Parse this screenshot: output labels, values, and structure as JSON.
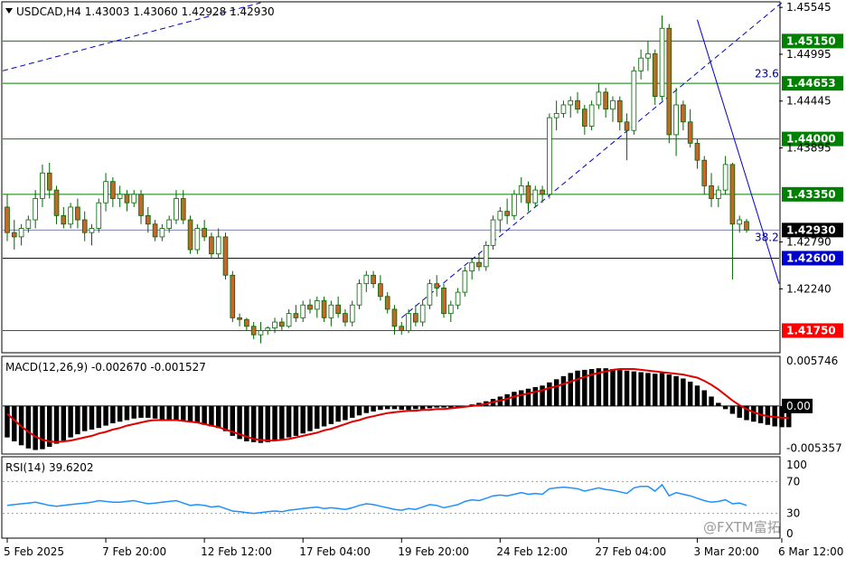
{
  "chart_data": [
    {
      "type": "candlestick",
      "panel": "price",
      "header": "USDCAD,H4  1.43003 1.43060 1.42928 1.42930",
      "header_marker": "triangle-down-icon",
      "ylim": [
        1.415,
        1.456
      ],
      "y_ticks": [
        "1.45545",
        "1.44995",
        "1.44445",
        "1.43895",
        "1.42790",
        "1.42240"
      ],
      "y_tick_values": [
        1.45545,
        1.44995,
        1.44445,
        1.43895,
        1.4279,
        1.4224
      ],
      "levels": [
        {
          "label": "1.45150",
          "value": 1.4515,
          "color": "#008000",
          "label_bg": "#008000",
          "label_color": "#ffffff"
        },
        {
          "label": "1.44653",
          "value": 1.44653,
          "color": "#008000",
          "label_bg": "#008000",
          "label_color": "#ffffff"
        },
        {
          "label": "1.44000",
          "value": 1.44,
          "color": "#008000",
          "label_bg": "#008000",
          "label_color": "#ffffff"
        },
        {
          "label": "1.43350",
          "value": 1.4335,
          "color": "#008000",
          "label_bg": "#008000",
          "label_color": "#ffffff"
        },
        {
          "label": "1.42930",
          "value": 1.4293,
          "color": "#7f7fae",
          "label_bg": "#000000",
          "label_color": "#ffffff"
        },
        {
          "label": "1.42600",
          "value": 1.426,
          "color": "#0000cc",
          "label_bg": "#0000cc",
          "label_color": "#ffffff"
        },
        {
          "label": "1.41750",
          "value": 1.4175,
          "color": "#ff0000",
          "label_bg": "#ff0000",
          "label_color": "#ffffff"
        }
      ],
      "fib_labels": [
        {
          "label": "23.6",
          "value": 1.4469
        },
        {
          "label": "38.2",
          "value": 1.4277
        }
      ],
      "candles": [
        [
          1.432,
          1.4335,
          1.428,
          1.429
        ],
        [
          1.429,
          1.4305,
          1.427,
          1.4285
        ],
        [
          1.4285,
          1.43,
          1.4275,
          1.4295
        ],
        [
          1.4295,
          1.431,
          1.429,
          1.4305
        ],
        [
          1.4305,
          1.434,
          1.4295,
          1.433
        ],
        [
          1.433,
          1.437,
          1.432,
          1.436
        ],
        [
          1.436,
          1.4372,
          1.433,
          1.434
        ],
        [
          1.434,
          1.4345,
          1.43,
          1.431
        ],
        [
          1.431,
          1.432,
          1.4295,
          1.43
        ],
        [
          1.43,
          1.4325,
          1.4295,
          1.432
        ],
        [
          1.432,
          1.433,
          1.4295,
          1.4305
        ],
        [
          1.4305,
          1.4315,
          1.428,
          1.429
        ],
        [
          1.429,
          1.43,
          1.4275,
          1.4295
        ],
        [
          1.4295,
          1.433,
          1.429,
          1.4325
        ],
        [
          1.4325,
          1.436,
          1.4315,
          1.435
        ],
        [
          1.435,
          1.4355,
          1.432,
          1.433
        ],
        [
          1.433,
          1.4345,
          1.432,
          1.4335
        ],
        [
          1.4335,
          1.434,
          1.4315,
          1.4325
        ],
        [
          1.4325,
          1.434,
          1.432,
          1.4335
        ],
        [
          1.4335,
          1.434,
          1.43,
          1.431
        ],
        [
          1.431,
          1.432,
          1.429,
          1.43
        ],
        [
          1.43,
          1.4305,
          1.428,
          1.4285
        ],
        [
          1.4285,
          1.43,
          1.428,
          1.4295
        ],
        [
          1.4295,
          1.431,
          1.429,
          1.4305
        ],
        [
          1.4305,
          1.434,
          1.43,
          1.433
        ],
        [
          1.433,
          1.434,
          1.43,
          1.4305
        ],
        [
          1.4305,
          1.431,
          1.4265,
          1.427
        ],
        [
          1.427,
          1.43,
          1.4265,
          1.4295
        ],
        [
          1.4295,
          1.4305,
          1.428,
          1.4285
        ],
        [
          1.4285,
          1.429,
          1.426,
          1.4265
        ],
        [
          1.4265,
          1.4295,
          1.426,
          1.4285
        ],
        [
          1.4285,
          1.429,
          1.4235,
          1.424
        ],
        [
          1.424,
          1.4245,
          1.4185,
          1.419
        ],
        [
          1.419,
          1.4195,
          1.418,
          1.4188
        ],
        [
          1.4188,
          1.419,
          1.4175,
          1.418
        ],
        [
          1.418,
          1.4185,
          1.4165,
          1.417
        ],
        [
          1.417,
          1.4185,
          1.416,
          1.4175
        ],
        [
          1.4175,
          1.418,
          1.417,
          1.4178
        ],
        [
          1.4178,
          1.419,
          1.4172,
          1.4185
        ],
        [
          1.4185,
          1.419,
          1.4175,
          1.418
        ],
        [
          1.418,
          1.42,
          1.4178,
          1.4195
        ],
        [
          1.4195,
          1.4205,
          1.4185,
          1.419
        ],
        [
          1.419,
          1.421,
          1.4185,
          1.4205
        ],
        [
          1.4205,
          1.4212,
          1.4195,
          1.42
        ],
        [
          1.42,
          1.4215,
          1.419,
          1.421
        ],
        [
          1.421,
          1.4215,
          1.4185,
          1.419
        ],
        [
          1.419,
          1.421,
          1.418,
          1.4205
        ],
        [
          1.4205,
          1.4215,
          1.419,
          1.4195
        ],
        [
          1.4195,
          1.42,
          1.418,
          1.4185
        ],
        [
          1.4185,
          1.421,
          1.418,
          1.4205
        ],
        [
          1.4205,
          1.4235,
          1.42,
          1.423
        ],
        [
          1.423,
          1.4245,
          1.422,
          1.424
        ],
        [
          1.424,
          1.4245,
          1.4225,
          1.423
        ],
        [
          1.423,
          1.424,
          1.421,
          1.4215
        ],
        [
          1.4215,
          1.422,
          1.4195,
          1.42
        ],
        [
          1.42,
          1.4205,
          1.417,
          1.418
        ],
        [
          1.418,
          1.4185,
          1.417,
          1.4175
        ],
        [
          1.4175,
          1.42,
          1.4172,
          1.4195
        ],
        [
          1.4195,
          1.4205,
          1.418,
          1.4185
        ],
        [
          1.4185,
          1.421,
          1.418,
          1.4205
        ],
        [
          1.4205,
          1.4235,
          1.42,
          1.423
        ],
        [
          1.423,
          1.424,
          1.4215,
          1.4225
        ],
        [
          1.4225,
          1.423,
          1.419,
          1.4195
        ],
        [
          1.4195,
          1.421,
          1.4185,
          1.4205
        ],
        [
          1.4205,
          1.4225,
          1.42,
          1.422
        ],
        [
          1.422,
          1.425,
          1.4215,
          1.4245
        ],
        [
          1.4245,
          1.426,
          1.4235,
          1.4255
        ],
        [
          1.4255,
          1.4265,
          1.4245,
          1.425
        ],
        [
          1.425,
          1.428,
          1.4245,
          1.4275
        ],
        [
          1.4275,
          1.431,
          1.427,
          1.4305
        ],
        [
          1.4305,
          1.432,
          1.429,
          1.4315
        ],
        [
          1.4315,
          1.433,
          1.43,
          1.431
        ],
        [
          1.431,
          1.434,
          1.4305,
          1.4335
        ],
        [
          1.4335,
          1.4355,
          1.4325,
          1.4345
        ],
        [
          1.4345,
          1.435,
          1.4315,
          1.4325
        ],
        [
          1.4325,
          1.4345,
          1.432,
          1.434
        ],
        [
          1.434,
          1.4345,
          1.4325,
          1.4335
        ],
        [
          1.4335,
          1.443,
          1.433,
          1.4425
        ],
        [
          1.4425,
          1.4445,
          1.441,
          1.443
        ],
        [
          1.443,
          1.4445,
          1.4425,
          1.444
        ],
        [
          1.444,
          1.445,
          1.4425,
          1.4445
        ],
        [
          1.4445,
          1.4455,
          1.443,
          1.4435
        ],
        [
          1.4435,
          1.444,
          1.4405,
          1.4415
        ],
        [
          1.4415,
          1.4445,
          1.441,
          1.444
        ],
        [
          1.444,
          1.4465,
          1.4435,
          1.4455
        ],
        [
          1.4455,
          1.446,
          1.4425,
          1.4435
        ],
        [
          1.4435,
          1.445,
          1.442,
          1.4445
        ],
        [
          1.4445,
          1.445,
          1.441,
          1.442
        ],
        [
          1.442,
          1.443,
          1.4375,
          1.441
        ],
        [
          1.441,
          1.4485,
          1.4405,
          1.448
        ],
        [
          1.448,
          1.4505,
          1.447,
          1.4495
        ],
        [
          1.4495,
          1.4515,
          1.448,
          1.45
        ],
        [
          1.45,
          1.4505,
          1.444,
          1.445
        ],
        [
          1.445,
          1.4545,
          1.4445,
          1.453
        ],
        [
          1.453,
          1.4535,
          1.4395,
          1.4405
        ],
        [
          1.4405,
          1.446,
          1.438,
          1.444
        ],
        [
          1.444,
          1.4445,
          1.441,
          1.442
        ],
        [
          1.442,
          1.4435,
          1.439,
          1.4395
        ],
        [
          1.4395,
          1.44,
          1.4365,
          1.4375
        ],
        [
          1.4375,
          1.438,
          1.4335,
          1.4345
        ],
        [
          1.4345,
          1.436,
          1.432,
          1.433
        ],
        [
          1.433,
          1.4345,
          1.432,
          1.434
        ],
        [
          1.434,
          1.438,
          1.4335,
          1.437
        ],
        [
          1.437,
          1.4372,
          1.4235,
          1.43
        ],
        [
          1.43,
          1.431,
          1.429,
          1.4305
        ],
        [
          1.4303,
          1.4306,
          1.429,
          1.4293
        ]
      ]
    },
    {
      "type": "bar+line",
      "panel": "macd",
      "header": "MACD(12,26,9) -0.002670 -0.001527",
      "ylim": [
        -0.006,
        0.0062
      ],
      "y_ticks": [
        "0.005746",
        "0.00",
        "-0.005357"
      ],
      "y_tick_values": [
        0.005746,
        0.0,
        -0.005357
      ],
      "zero_label_bg": "#000000",
      "histogram_color": "#000000",
      "signal_color": "#e00000",
      "histogram": [
        -0.004,
        -0.0045,
        -0.005,
        -0.0054,
        -0.0056,
        -0.0055,
        -0.0052,
        -0.0048,
        -0.0044,
        -0.004,
        -0.0036,
        -0.0032,
        -0.003,
        -0.0028,
        -0.0025,
        -0.0022,
        -0.002,
        -0.0018,
        -0.0016,
        -0.0015,
        -0.0015,
        -0.0016,
        -0.0017,
        -0.0018,
        -0.0018,
        -0.0018,
        -0.002,
        -0.0022,
        -0.0024,
        -0.0026,
        -0.0028,
        -0.0032,
        -0.0038,
        -0.0042,
        -0.0045,
        -0.0046,
        -0.0047,
        -0.0046,
        -0.0044,
        -0.0042,
        -0.004,
        -0.0038,
        -0.0035,
        -0.0032,
        -0.0029,
        -0.0026,
        -0.0023,
        -0.002,
        -0.0018,
        -0.0015,
        -0.0012,
        -0.0009,
        -0.0007,
        -0.0005,
        -0.0004,
        -0.0004,
        -0.0005,
        -0.0005,
        -0.0004,
        -0.0004,
        -0.0003,
        -0.0002,
        -0.0002,
        -0.0002,
        -0.0001,
        0.0,
        0.0002,
        0.0004,
        0.0006,
        0.0009,
        0.0012,
        0.0015,
        0.0018,
        0.002,
        0.0022,
        0.0024,
        0.0026,
        0.003,
        0.0034,
        0.0038,
        0.0042,
        0.0045,
        0.0046,
        0.0047,
        0.0048,
        0.0048,
        0.0047,
        0.0046,
        0.0045,
        0.0044,
        0.0043,
        0.0042,
        0.0041,
        0.0042,
        0.004,
        0.0038,
        0.0035,
        0.0031,
        0.0026,
        0.002,
        0.0012,
        0.0004,
        -0.0004,
        -0.001,
        -0.0015,
        -0.0018,
        -0.002,
        -0.0022,
        -0.0024,
        -0.0026,
        -0.0027,
        -0.0027
      ],
      "signal": [
        -0.001,
        -0.0018,
        -0.0026,
        -0.0033,
        -0.0039,
        -0.0043,
        -0.0045,
        -0.0046,
        -0.0045,
        -0.0044,
        -0.0042,
        -0.004,
        -0.0038,
        -0.0035,
        -0.0033,
        -0.003,
        -0.0028,
        -0.0025,
        -0.0023,
        -0.0021,
        -0.0019,
        -0.0018,
        -0.0018,
        -0.0018,
        -0.0018,
        -0.0019,
        -0.002,
        -0.0021,
        -0.0023,
        -0.0025,
        -0.0027,
        -0.003,
        -0.0033,
        -0.0036,
        -0.0039,
        -0.0042,
        -0.0043,
        -0.0044,
        -0.0044,
        -0.0043,
        -0.0042,
        -0.004,
        -0.0038,
        -0.0036,
        -0.0034,
        -0.0031,
        -0.0029,
        -0.0026,
        -0.0023,
        -0.002,
        -0.0018,
        -0.0015,
        -0.0013,
        -0.0011,
        -0.0009,
        -0.0008,
        -0.0007,
        -0.0006,
        -0.0006,
        -0.0005,
        -0.0005,
        -0.0004,
        -0.0004,
        -0.0003,
        -0.0002,
        -0.0001,
        0.0,
        0.0001,
        0.0003,
        0.0005,
        0.0007,
        0.0009,
        0.0012,
        0.0014,
        0.0016,
        0.0018,
        0.002,
        0.0023,
        0.0025,
        0.0028,
        0.0031,
        0.0034,
        0.0037,
        0.004,
        0.0042,
        0.0044,
        0.0046,
        0.0047,
        0.0047,
        0.0047,
        0.0046,
        0.0045,
        0.0044,
        0.0043,
        0.0042,
        0.0041,
        0.004,
        0.0038,
        0.0036,
        0.0032,
        0.0027,
        0.0021,
        0.0014,
        0.0007,
        0.0001,
        -0.0004,
        -0.0008,
        -0.0011,
        -0.0013,
        -0.0014,
        -0.0015,
        -0.0015
      ]
    },
    {
      "type": "line",
      "panel": "rsi",
      "header": "RSI(14) 39.6202",
      "ylim": [
        0,
        100
      ],
      "y_ticks": [
        "100",
        "70",
        "30",
        "0"
      ],
      "y_tick_values": [
        100,
        70,
        30,
        0
      ],
      "line_color": "#1e90ff",
      "values": [
        40,
        41,
        42,
        43,
        44,
        42,
        40,
        39,
        40,
        41,
        42,
        43,
        44,
        46,
        45,
        44,
        44,
        45,
        46,
        44,
        42,
        43,
        44,
        45,
        46,
        43,
        40,
        41,
        40,
        38,
        39,
        36,
        33,
        32,
        31,
        30,
        31,
        32,
        33,
        32,
        34,
        35,
        36,
        37,
        38,
        36,
        37,
        36,
        35,
        37,
        40,
        42,
        41,
        39,
        37,
        35,
        34,
        36,
        35,
        38,
        41,
        40,
        37,
        39,
        41,
        45,
        47,
        46,
        49,
        52,
        53,
        52,
        54,
        56,
        54,
        55,
        54,
        61,
        62,
        63,
        62,
        61,
        58,
        60,
        62,
        60,
        59,
        57,
        55,
        62,
        64,
        64,
        58,
        66,
        52,
        56,
        54,
        52,
        49,
        46,
        44,
        45,
        47,
        42,
        43,
        40
      ],
      "watermark": "@FXTM富拓"
    }
  ],
  "time_axis": {
    "labels": [
      "5 Feb 2025",
      "7 Feb 20:00",
      "12 Feb 12:00",
      "17 Feb 04:00",
      "19 Feb 20:00",
      "24 Feb 12:00",
      "27 Feb 04:00",
      "3 Mar 20:00",
      "6 Mar 12:00"
    ],
    "label_candle_index": [
      0,
      14,
      28,
      42,
      56,
      70,
      84,
      98,
      110
    ]
  },
  "colors": {
    "bull_body": "#ffffff",
    "bear_body": "#c0692a",
    "candle_outline": "#006400",
    "trend_line": "#0000cc",
    "dotted_line": "#999999"
  }
}
